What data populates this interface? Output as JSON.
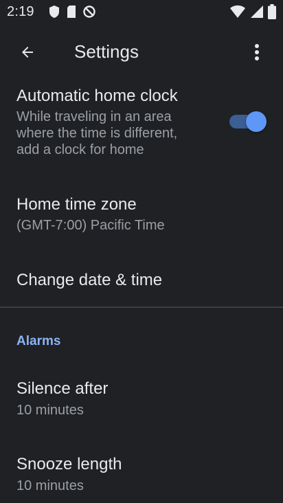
{
  "status_bar": {
    "time": "2:19",
    "left_icons": [
      "shield-icon",
      "sd-card-icon",
      "data-saver-icon"
    ],
    "right_icons": [
      "wifi-icon",
      "signal-icon",
      "battery-icon"
    ]
  },
  "app_bar": {
    "title": "Settings",
    "back_icon": "arrow-back-icon",
    "more_icon": "more-vert-icon"
  },
  "settings": {
    "auto_home_clock": {
      "title": "Automatic home clock",
      "subtitle": "While traveling in an area where the time is different, add a clock for home",
      "enabled": true
    },
    "home_time_zone": {
      "title": "Home time zone",
      "value": "(GMT-7:00) Pacific Time"
    },
    "change_date_time": {
      "title": "Change date & time"
    }
  },
  "alarms": {
    "header": "Alarms",
    "silence_after": {
      "title": "Silence after",
      "value": "10 minutes"
    },
    "snooze_length": {
      "title": "Snooze length",
      "value": "10 minutes"
    }
  },
  "colors": {
    "background": "#202124",
    "text_primary": "#e8eaed",
    "text_secondary": "#9aa0a6",
    "accent": "#8ab4f8",
    "switch_on": "#5e97f6"
  }
}
